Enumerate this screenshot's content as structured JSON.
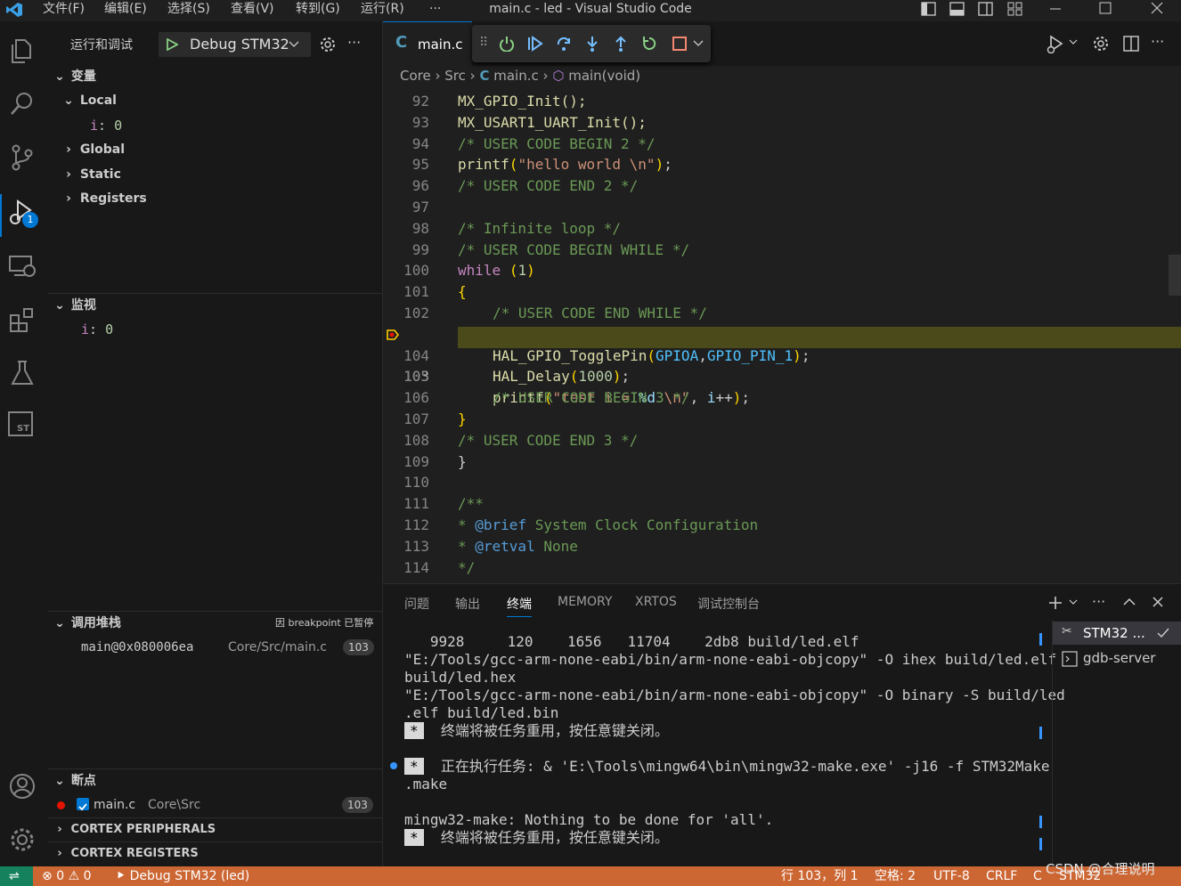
{
  "titlebar": {
    "menus": [
      "文件(F)",
      "编辑(E)",
      "选择(S)",
      "查看(V)",
      "转到(G)",
      "运行(R)",
      "···"
    ],
    "title": "main.c - led - Visual Studio Code"
  },
  "activity_bar": {
    "debug_badge": "1",
    "st_label": "ST"
  },
  "sidebar": {
    "run_debug_title": "运行和调试",
    "config_name": "Debug STM32",
    "variables": {
      "header": "变量",
      "local": "Local",
      "local_var_name": "i",
      "local_var_value": "0",
      "global": "Global",
      "static": "Static",
      "registers": "Registers"
    },
    "watch": {
      "header": "监视",
      "var_name": "i",
      "var_value": "0"
    },
    "callstack": {
      "header": "调用堆栈",
      "status": "因 breakpoint 已暂停",
      "frame": "main@0x080006ea",
      "path": "Core/Src/main.c",
      "line": "103"
    },
    "breakpoints": {
      "header": "断点",
      "file": "main.c",
      "path": "Core\\Src",
      "line": "103"
    },
    "cortex_peripherals": "CORTEX PERIPHERALS",
    "cortex_registers": "CORTEX REGISTERS"
  },
  "editor": {
    "tab_name": "main.c",
    "breadcrumb": [
      "Core",
      "Src",
      "main.c",
      "main(void)"
    ],
    "lines": [
      {
        "n": "92"
      },
      {
        "n": "93"
      },
      {
        "n": "94"
      },
      {
        "n": "95"
      },
      {
        "n": "96"
      },
      {
        "n": "97"
      },
      {
        "n": "98"
      },
      {
        "n": "99"
      },
      {
        "n": "100"
      },
      {
        "n": "101"
      },
      {
        "n": "102"
      },
      {
        "n": "103"
      },
      {
        "n": "104"
      },
      {
        "n": "105"
      },
      {
        "n": "106"
      },
      {
        "n": "107"
      },
      {
        "n": "108"
      },
      {
        "n": "109"
      },
      {
        "n": "110"
      },
      {
        "n": "111"
      },
      {
        "n": "112"
      },
      {
        "n": "113"
      },
      {
        "n": "114"
      }
    ],
    "code": {
      "l92": "MX_GPIO_Init();",
      "l93": "MX_USART1_UART_Init();",
      "l94": "/* USER CODE BEGIN 2 */",
      "l95_fn": "printf",
      "l95_str": "\"hello world \\n\"",
      "l96": "/* USER CODE END 2 */",
      "l98": "/* Infinite loop */",
      "l99": "/* USER CODE BEGIN WHILE */",
      "l100_kw": "while",
      "l100_num": "1",
      "l102": "/* USER CODE END WHILE */",
      "l103_fn": "printf",
      "l103_str1": "\"test i = ",
      "l103_fmt": "%d",
      "l103_str2": " \\n\"",
      "l103_var": "i",
      "l104_fn": "HAL_GPIO_TogglePin",
      "l104_a1": "GPIOA",
      "l104_a2": "GPIO_PIN_1",
      "l105_fn": "HAL_Delay",
      "l105_num": "1000",
      "l106": "/* USER CODE BEGIN 3 */",
      "l108": "/* USER CODE END 3 */",
      "l111": "/**",
      "l112_tag": "@brief",
      "l112_text": "System Clock Configuration",
      "l113_tag": "@retval",
      "l113_text": "None",
      "l114": "*/"
    }
  },
  "panel": {
    "tabs": [
      "问题",
      "输出",
      "终端",
      "MEMORY",
      "XRTOS",
      "调试控制台"
    ],
    "active_tab": "终端",
    "terminal_lines": [
      "   9928     120    1656   11704    2db8 build/led.elf",
      "\"E:/Tools/gcc-arm-none-eabi/bin/arm-none-eabi-objcopy\" -O ihex build/led.elf",
      "build/led.hex",
      "\"E:/Tools/gcc-arm-none-eabi/bin/arm-none-eabi-objcopy\" -O binary -S build/led",
      ".elf build/led.bin"
    ],
    "reuse_msg": "终端将被任务重用，按任意键关闭。",
    "exec_msg": "正在执行任务: & 'E:\\Tools\\mingw64\\bin\\mingw32-make.exe' -j16 -f STM32Make",
    "exec_msg2": ".make",
    "make_msg": "mingw32-make: Nothing to be done for 'all'.",
    "reuse_msg2": "终端将被任务重用，按任意键关闭。",
    "terminals": [
      "STM32 ...",
      "gdb-server"
    ]
  },
  "statusbar": {
    "errors": "0",
    "warnings": "0",
    "debug_label": "Debug STM32 (led)",
    "position": "行 103，列 1",
    "spaces": "空格: 2",
    "encoding": "UTF-8",
    "eol": "CRLF",
    "lang": "C",
    "target": "STM32",
    "watermark": "CSDN @合理说明"
  },
  "colors": {
    "statusbar": "#cc6633",
    "current_line": "#4b4a1a",
    "accent": "#0078d4"
  }
}
